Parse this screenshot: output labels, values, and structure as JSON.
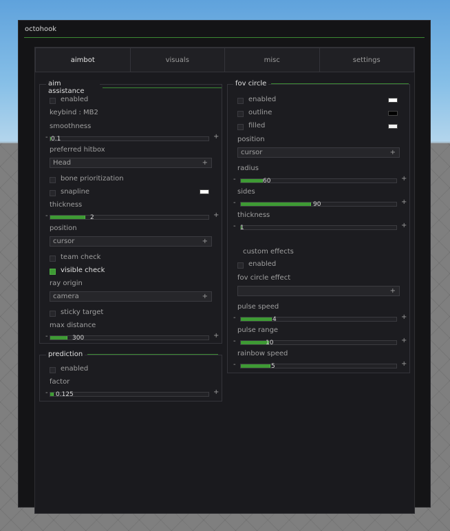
{
  "window": {
    "title": "octohook"
  },
  "tabs": [
    "aimbot",
    "visuals",
    "misc",
    "settings"
  ],
  "aim": {
    "header": "aim assistance",
    "enabled": "enabled",
    "keybind": "keybind : MB2",
    "smoothness": "smoothness",
    "smoothness_value": "0.1",
    "smoothness_fill": 0.0,
    "preferred_hitbox": "preferred hitbox",
    "hitbox_value": "Head",
    "bone_prioritization": "bone prioritization",
    "snapline": "snapline",
    "thickness": "thickness",
    "thickness_value": "2",
    "thickness_fill": 0.22,
    "position": "position",
    "position_value": "cursor",
    "team_check": "team check",
    "visible_check": "visible check",
    "visible_check_on": true,
    "ray_origin": "ray origin",
    "ray_origin_value": "camera",
    "sticky_target": "sticky target",
    "max_distance": "max distance",
    "max_distance_value": "300",
    "max_distance_fill": 0.11
  },
  "prediction": {
    "header": "prediction",
    "enabled": "enabled",
    "factor": "factor",
    "factor_value": "0.125",
    "factor_fill": 0.02
  },
  "fov": {
    "header": "fov circle",
    "enabled": "enabled",
    "outline": "outline",
    "filled": "filled",
    "position": "position",
    "position_value": "cursor",
    "radius": "radius",
    "radius_value": "60",
    "radius_fill": 0.14,
    "sides": "sides",
    "sides_value": "90",
    "sides_fill": 0.45,
    "thickness": "thickness",
    "thickness_value": "1",
    "thickness_fill": 0.0,
    "custom_effects": "custom effects",
    "ce_enabled": "enabled",
    "fov_circle_effect": "fov circle effect",
    "effect_value": "",
    "pulse_speed": "pulse speed",
    "pulse_speed_value": "4",
    "pulse_speed_fill": 0.2,
    "pulse_range": "pulse range",
    "pulse_range_value": "10",
    "pulse_range_fill": 0.18,
    "rainbow_speed": "rainbow speed",
    "rainbow_speed_value": "5",
    "rainbow_speed_fill": 0.19
  },
  "colors": {
    "accent": "#3e9a34",
    "panel": "#1c1c20",
    "white_swatch": "#ffffff",
    "black_swatch": "#000000"
  },
  "symbols": {
    "minus": "-",
    "plus": "+"
  }
}
